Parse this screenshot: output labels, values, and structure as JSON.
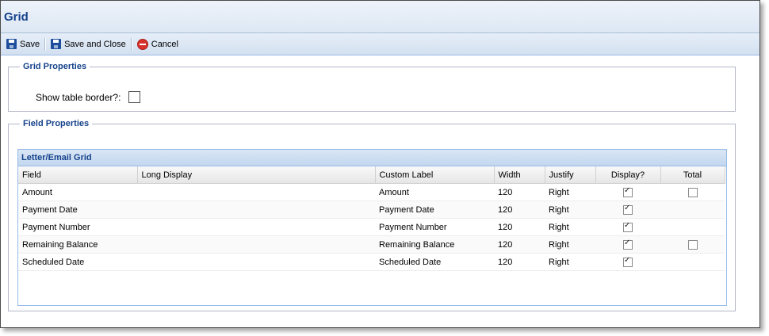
{
  "window": {
    "title": "Grid"
  },
  "toolbar": {
    "save": "Save",
    "save_and_close": "Save and Close",
    "cancel": "Cancel"
  },
  "grid_properties": {
    "legend": "Grid Properties",
    "show_table_border_label": "Show table border?:",
    "show_table_border": false
  },
  "field_properties": {
    "legend": "Field Properties",
    "grid_title": "Letter/Email Grid",
    "columns": [
      "Field",
      "Long Display",
      "Custom Label",
      "Width",
      "Justify",
      "Display?",
      "Total"
    ],
    "rows": [
      {
        "field": "Amount",
        "long_display": "",
        "custom_label": "Amount",
        "width": "120",
        "justify": "Right",
        "display": true,
        "total": false,
        "total_visible": true
      },
      {
        "field": "Payment Date",
        "long_display": "",
        "custom_label": "Payment Date",
        "width": "120",
        "justify": "Right",
        "display": true,
        "total": false,
        "total_visible": false
      },
      {
        "field": "Payment Number",
        "long_display": "",
        "custom_label": "Payment Number",
        "width": "120",
        "justify": "Right",
        "display": true,
        "total": false,
        "total_visible": false
      },
      {
        "field": "Remaining Balance",
        "long_display": "",
        "custom_label": "Remaining Balance",
        "width": "120",
        "justify": "Right",
        "display": true,
        "total": false,
        "total_visible": true
      },
      {
        "field": "Scheduled Date",
        "long_display": "",
        "custom_label": "Scheduled Date",
        "width": "120",
        "justify": "Right",
        "display": true,
        "total": false,
        "total_visible": false
      }
    ]
  },
  "icons": {
    "save": "save-disk-icon",
    "save_and_close": "save-disk-icon",
    "cancel": "cancel-circle-icon"
  },
  "colors": {
    "header_text": "#15428b",
    "toolbar_bg": "#d3e0f0",
    "border": "#99bbe8"
  }
}
